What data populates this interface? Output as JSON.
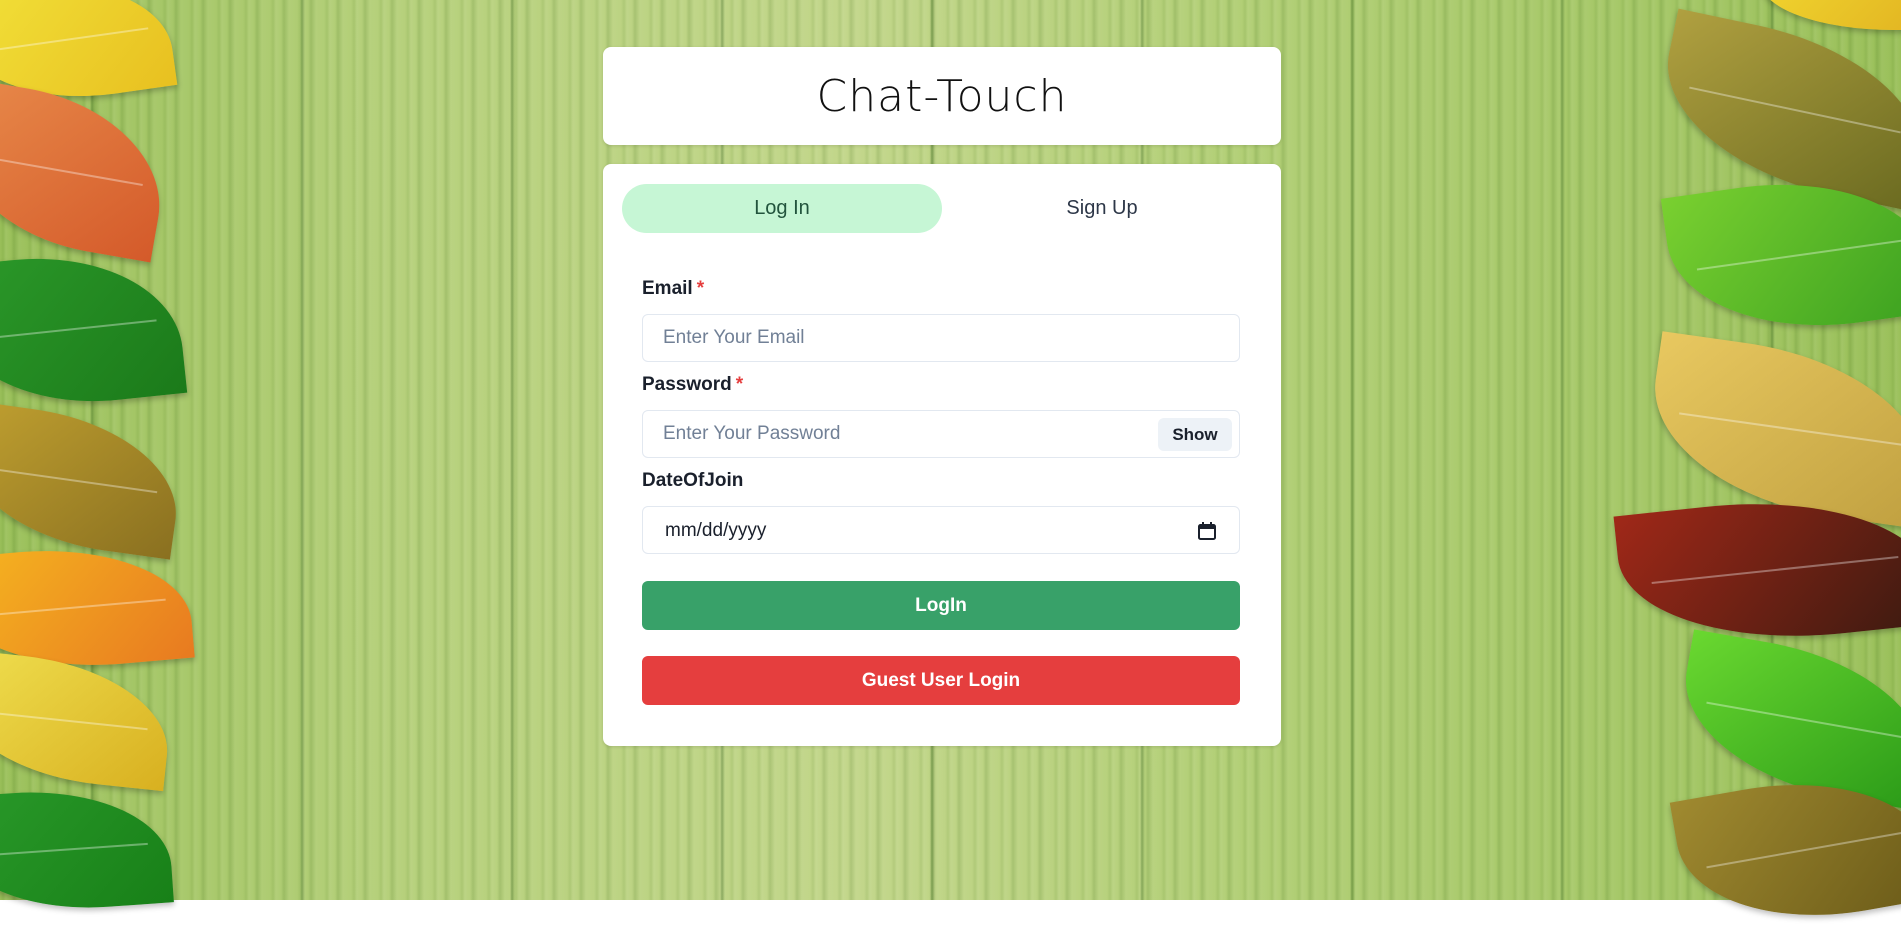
{
  "app": {
    "title": "Chat-Touch"
  },
  "tabs": [
    {
      "label": "Log In",
      "active": true
    },
    {
      "label": "Sign Up",
      "active": false
    }
  ],
  "form": {
    "email": {
      "label": "Email",
      "required_mark": "*",
      "value": "",
      "placeholder": "Enter Your Email"
    },
    "password": {
      "label": "Password",
      "required_mark": "*",
      "value": "",
      "placeholder": "Enter Your Password",
      "toggle_label": "Show"
    },
    "date_of_join": {
      "label": "DateOfJoin",
      "value": "mm/dd/yyyy"
    },
    "login_button": "LogIn",
    "guest_button": "Guest User Login"
  },
  "colors": {
    "accent_green": "#38a169",
    "active_tab_bg": "#c6f6d5",
    "danger_red": "#e53e3e",
    "required_red": "#e53e3e"
  },
  "icons": {
    "date_picker": "calendar-icon"
  }
}
